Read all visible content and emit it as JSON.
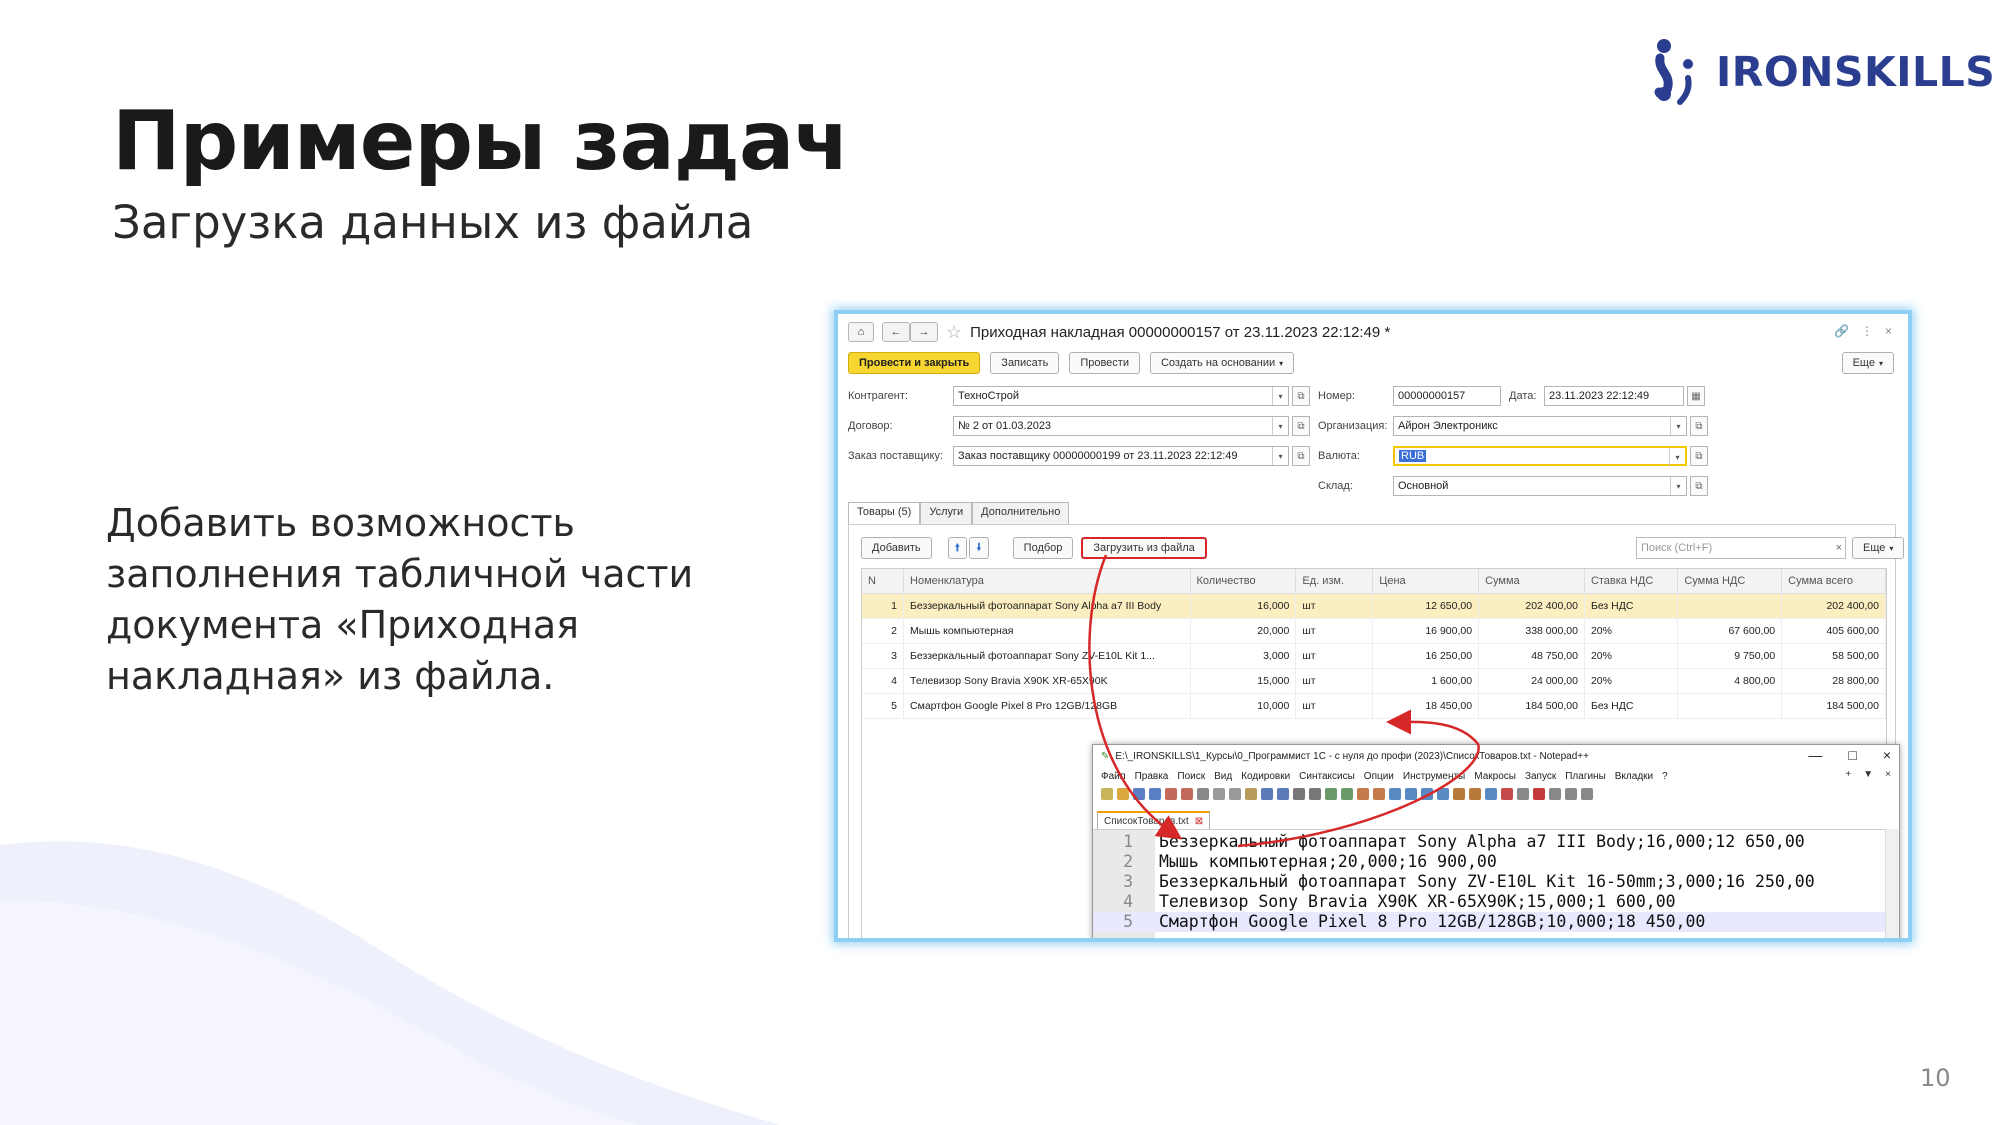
{
  "slide": {
    "title": "Примеры задач",
    "subtitle": "Загрузка данных из файла",
    "description": "Добавить возможность заполнения табличной части документа «Приходная накладная» из файла.",
    "page_number": "10",
    "logo_text": "IRONSKILLS",
    "colors": {
      "brand": "#2a3d8f",
      "accent_red": "#d62828",
      "button_yellow": "#f7d631",
      "wave": "#eef0fb"
    }
  },
  "onec": {
    "doc_title": "Приходная накладная 00000000157 от 23.11.2023 22:12:49 *",
    "icons": [
      "home-icon",
      "back-icon",
      "forward-icon",
      "star-icon",
      "link-icon",
      "menu-dots-icon",
      "close-icon"
    ],
    "buttons": {
      "post_close": "Провести и закрыть",
      "save": "Записать",
      "post": "Провести",
      "create_based": "Создать на основании",
      "more": "Еще"
    },
    "fields": {
      "counterparty_label": "Контрагент:",
      "counterparty_value": "ТехноСтрой",
      "contract_label": "Договор:",
      "contract_value": "№ 2 от 01.03.2023",
      "order_label": "Заказ поставщику:",
      "order_value": "Заказ поставщику 00000000199 от 23.11.2023 22:12:49",
      "number_label": "Номер:",
      "number_value": "00000000157",
      "date_label": "Дата:",
      "date_value": "23.11.2023 22:12:49",
      "org_label": "Организация:",
      "org_value": "Айрон Электроникс",
      "currency_label": "Валюта:",
      "currency_value": "RUB",
      "warehouse_label": "Склад:",
      "warehouse_value": "Основной"
    },
    "tabs": [
      "Товары (5)",
      "Услуги",
      "Дополнительно"
    ],
    "table_toolbar": {
      "add": "Добавить",
      "pick": "Подбор",
      "load_from_file": "Загрузить из файла",
      "search_placeholder": "Поиск (Ctrl+F)",
      "more": "Еще"
    },
    "columns": [
      "N",
      "Номенклатура",
      "Количество",
      "Ед. изм.",
      "Цена",
      "Сумма",
      "Ставка НДС",
      "Сумма НДС",
      "Сумма всего"
    ],
    "rows": [
      [
        "1",
        "Беззеркальный фотоаппарат Sony Alpha a7 III Body",
        "16,000",
        "шт",
        "12 650,00",
        "202 400,00",
        "Без НДС",
        "",
        "202 400,00"
      ],
      [
        "2",
        "Мышь компьютерная",
        "20,000",
        "шт",
        "16 900,00",
        "338 000,00",
        "20%",
        "67 600,00",
        "405 600,00"
      ],
      [
        "3",
        "Беззеркальный фотоаппарат Sony ZV-E10L Kit 1...",
        "3,000",
        "шт",
        "16 250,00",
        "48 750,00",
        "20%",
        "9 750,00",
        "58 500,00"
      ],
      [
        "4",
        "Телевизор Sony Bravia X90K XR-65X90K",
        "15,000",
        "шт",
        "1 600,00",
        "24 000,00",
        "20%",
        "4 800,00",
        "28 800,00"
      ],
      [
        "5",
        "Смартфон Google Pixel 8 Pro 12GB/128GB",
        "10,000",
        "шт",
        "18 450,00",
        "184 500,00",
        "Без НДС",
        "",
        "184 500,00"
      ]
    ]
  },
  "notepad": {
    "title": "E:\\_IRONSKILLS\\1_Курсы\\0_Программист 1С - с нуля до профи (2023)\\СписокТоваров.txt - Notepad++",
    "menu": [
      "Файл",
      "Правка",
      "Поиск",
      "Вид",
      "Кодировки",
      "Синтаксисы",
      "Опции",
      "Инструменты",
      "Макросы",
      "Запуск",
      "Плагины",
      "Вкладки",
      "?"
    ],
    "menu_right": [
      "+",
      "▼",
      "×"
    ],
    "tab": "СписокТоваров.txt",
    "lines": [
      {
        "no": "1",
        "text": "Беззеркальный фотоаппарат Sony Alpha a7 III Body;16,000;12 650,00"
      },
      {
        "no": "2",
        "text": "Мышь компьютерная;20,000;16 900,00"
      },
      {
        "no": "3",
        "text": "Беззеркальный фотоаппарат Sony ZV-E10L Kit 16-50mm;3,000;16 250,00"
      },
      {
        "no": "4",
        "text": "Телевизор Sony Bravia X90K XR-65X90K;15,000;1 600,00"
      },
      {
        "no": "5",
        "text": "Смартфон Google Pixel 8 Pro 12GB/128GB;10,000;18 450,00"
      }
    ]
  }
}
